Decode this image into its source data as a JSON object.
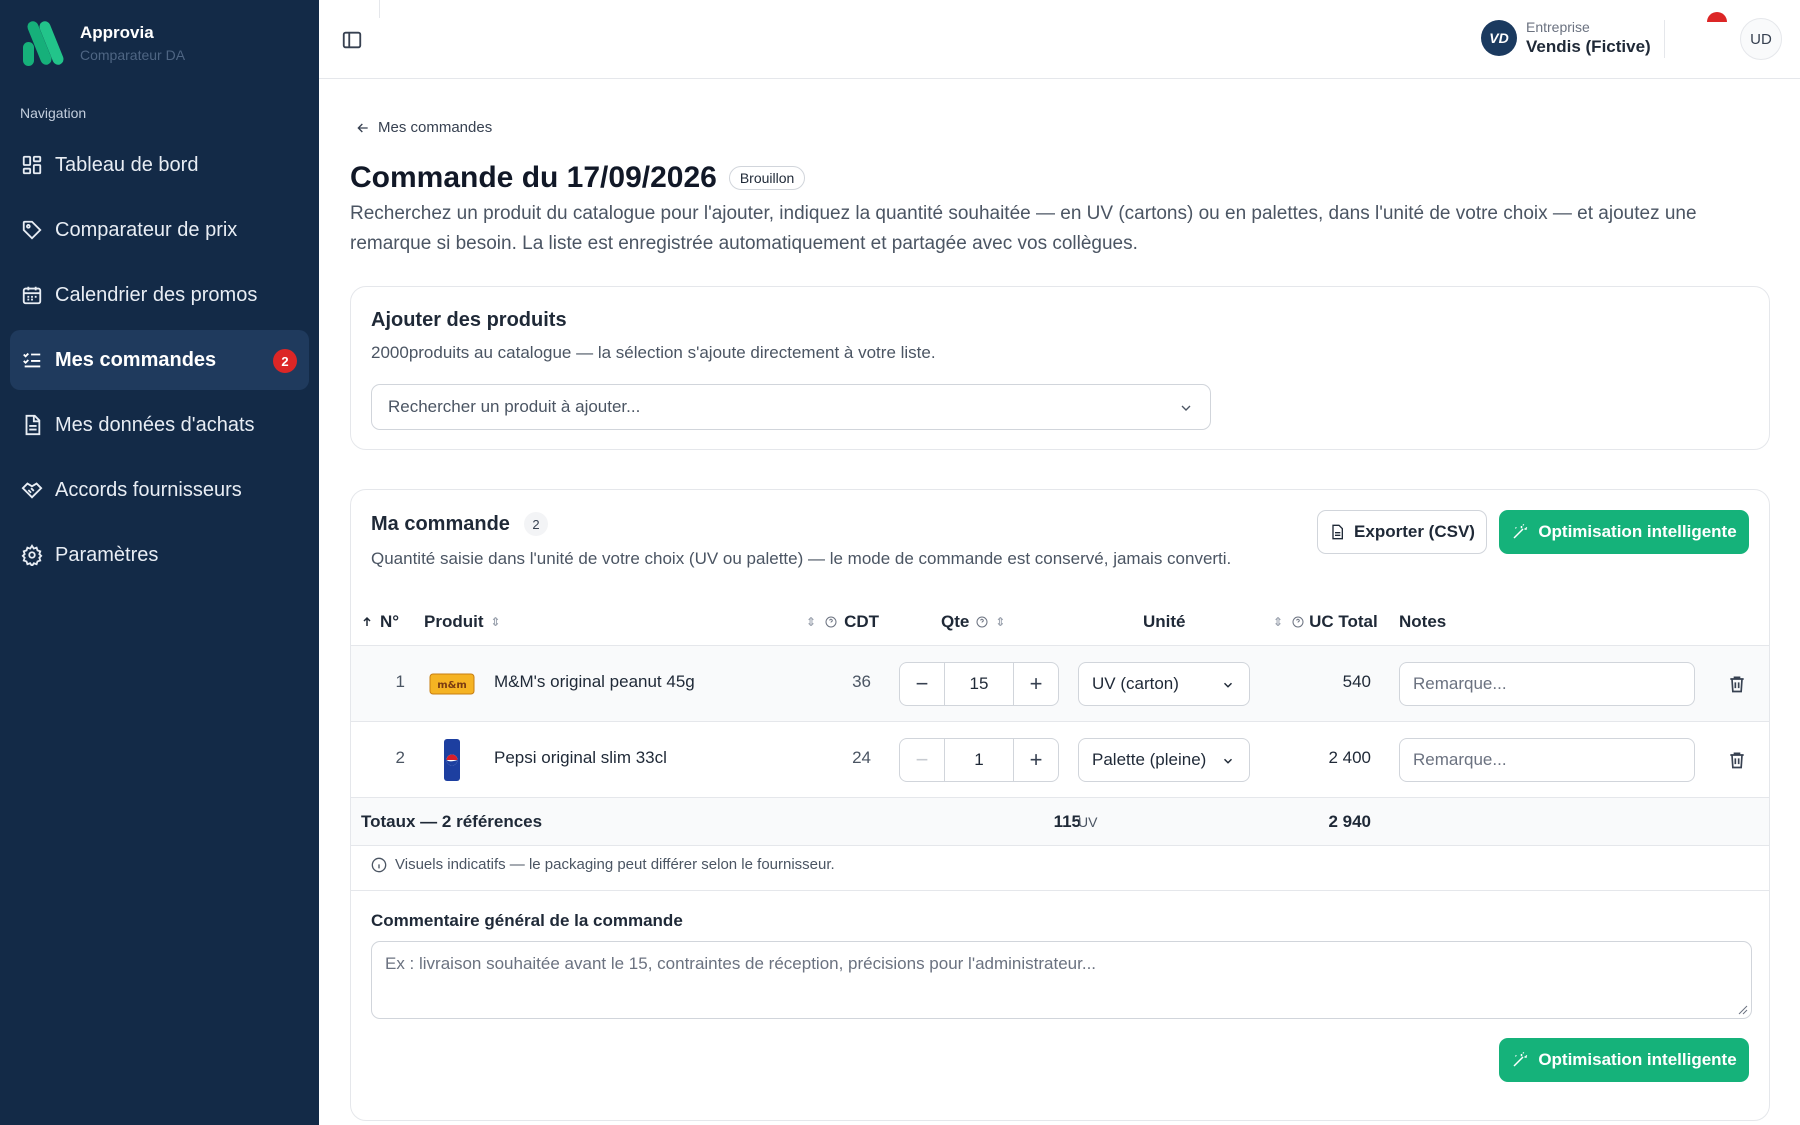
{
  "brand": {
    "name": "Approvia",
    "subtitle": "Comparateur DA"
  },
  "sidebar": {
    "heading": "Navigation",
    "items": [
      {
        "label": "Tableau de bord",
        "icon": "dashboard-icon"
      },
      {
        "label": "Comparateur de prix",
        "icon": "tag-icon"
      },
      {
        "label": "Calendrier des promos",
        "icon": "calendar-icon"
      },
      {
        "label": "Mes commandes",
        "icon": "checklist-icon",
        "active": true,
        "badge": "2"
      },
      {
        "label": "Mes données d'achats",
        "icon": "document-icon"
      },
      {
        "label": "Accords fournisseurs",
        "icon": "handshake-icon"
      },
      {
        "label": "Paramètres",
        "icon": "gear-icon"
      }
    ]
  },
  "topbar": {
    "company_label": "Entreprise",
    "company_name": "Vendis (Fictive)",
    "company_logo": "VD",
    "avatar_initials": "UD"
  },
  "page": {
    "back_label": "Mes commandes",
    "title": "Commande du 17/09/2026",
    "status": "Brouillon",
    "description": "Recherchez un produit du catalogue pour l'ajouter, indiquez la quantité souhaitée — en UV (cartons) ou en palettes, dans l'unité de votre choix — et ajoutez une remarque si besoin. La liste est enregistrée automatiquement et partagée avec vos collègues."
  },
  "add_products": {
    "title": "Ajouter des produits",
    "subtitle": "2000produits au catalogue — la sélection s'ajoute directement à votre liste.",
    "search_placeholder": "Rechercher un produit à ajouter..."
  },
  "order": {
    "title": "Ma commande",
    "count": "2",
    "subtitle": "Quantité saisie dans l'unité de votre choix (UV ou palette) — le mode de commande est conservé, jamais converti.",
    "export_label": "Exporter (CSV)",
    "optimize_label": "Optimisation intelligente",
    "columns": {
      "num": "N°",
      "product": "Produit",
      "cdt": "CDT",
      "qty": "Qte",
      "unit": "Unité",
      "uc_total": "UC Total",
      "notes": "Notes"
    },
    "rows": [
      {
        "num": "1",
        "product": "M&M's original peanut 45g",
        "cdt": "36",
        "qty": "15",
        "unit": "UV (carton)",
        "uc_total": "540",
        "notes_placeholder": "Remarque...",
        "image": "mms-pack-icon"
      },
      {
        "num": "2",
        "product": "Pepsi original slim 33cl",
        "cdt": "24",
        "qty": "1",
        "unit": "Palette (pleine)",
        "uc_total": "2 400",
        "notes_placeholder": "Remarque...",
        "image": "pepsi-can-icon"
      }
    ],
    "totals": {
      "label": "Totaux — 2 références",
      "qty": "115",
      "unit": "UV",
      "uc_total": "2 940"
    },
    "info_note": "Visuels indicatifs — le packaging peut différer selon le fournisseur.",
    "comment_label": "Commentaire général de la commande",
    "comment_placeholder": "Ex : livraison souhaitée avant le 15, contraintes de réception, précisions pour l'administrateur..."
  },
  "colors": {
    "sidebar_bg": "#132a47",
    "accent_green": "#15b27a",
    "badge_red": "#dc2626"
  }
}
